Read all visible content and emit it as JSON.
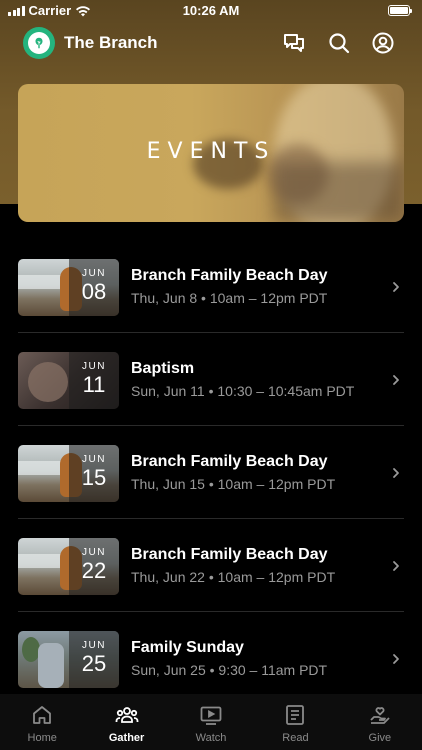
{
  "status_bar": {
    "carrier": "Carrier",
    "time": "10:26 AM",
    "icons": [
      "signal-icon",
      "wifi-icon",
      "battery-icon"
    ]
  },
  "header": {
    "app_title": "The Branch",
    "icons": [
      "chat-icon",
      "search-icon",
      "profile-icon"
    ],
    "logo_color": "#24b47e"
  },
  "hero": {
    "title": "EVENTS"
  },
  "events": [
    {
      "month": "JUN",
      "day": "08",
      "title": "Branch Family Beach Day",
      "subtitle": "Thu, Jun 8 • 10am – 12pm PDT",
      "thumb": "beach"
    },
    {
      "month": "JUN",
      "day": "11",
      "title": "Baptism",
      "subtitle": "Sun, Jun 11 • 10:30 – 10:45am PDT",
      "thumb": "baptism"
    },
    {
      "month": "JUN",
      "day": "15",
      "title": "Branch Family Beach Day",
      "subtitle": "Thu, Jun 15 • 10am – 12pm PDT",
      "thumb": "beach"
    },
    {
      "month": "JUN",
      "day": "22",
      "title": "Branch Family Beach Day",
      "subtitle": "Thu, Jun 22 • 10am – 12pm PDT",
      "thumb": "beach"
    },
    {
      "month": "JUN",
      "day": "25",
      "title": "Family Sunday",
      "subtitle": "Sun, Jun 25 • 9:30 – 11am PDT",
      "thumb": "family"
    }
  ],
  "tab_bar": {
    "tabs": [
      {
        "label": "Home",
        "icon": "home-icon",
        "active": false
      },
      {
        "label": "Gather",
        "icon": "people-icon",
        "active": true
      },
      {
        "label": "Watch",
        "icon": "video-icon",
        "active": false
      },
      {
        "label": "Read",
        "icon": "book-icon",
        "active": false
      },
      {
        "label": "Give",
        "icon": "give-icon",
        "active": false
      }
    ]
  },
  "colors": {
    "header_bg": "#745a2a",
    "background": "#000000",
    "subtitle": "#9a9a9a",
    "inactive_tab": "#8a8a8a"
  }
}
